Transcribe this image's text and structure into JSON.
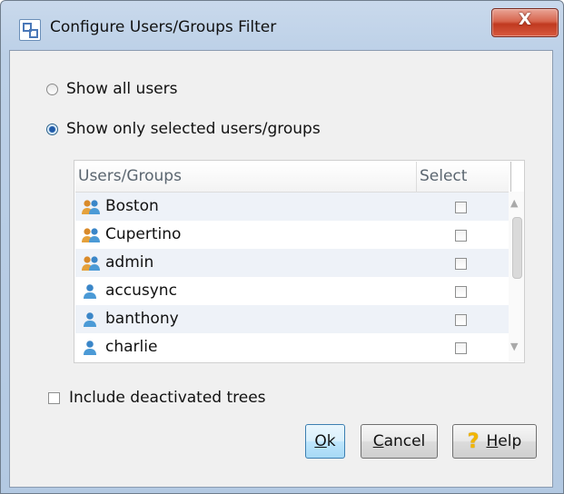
{
  "window": {
    "title": "Configure Users/Groups Filter",
    "close_label": "X"
  },
  "filter": {
    "option_all": "Show all users",
    "option_selected": "Show only selected users/groups",
    "selected_option": "option_selected"
  },
  "table": {
    "columns": [
      "Users/Groups",
      "Select"
    ],
    "rows": [
      {
        "name": "Boston",
        "type": "group-icon",
        "selected": false
      },
      {
        "name": "Cupertino",
        "type": "group-icon",
        "selected": false
      },
      {
        "name": "admin",
        "type": "group-icon",
        "selected": false
      },
      {
        "name": "accusync",
        "type": "user-icon",
        "selected": false
      },
      {
        "name": "banthony",
        "type": "user-icon",
        "selected": false
      },
      {
        "name": "charlie",
        "type": "user-icon",
        "selected": false
      }
    ]
  },
  "include_deactivated": {
    "label": "Include deactivated trees",
    "checked": false
  },
  "buttons": {
    "ok": {
      "mnemonic": "O",
      "rest": "k"
    },
    "cancel": {
      "mnemonic": "C",
      "rest": "ancel"
    },
    "help": {
      "mnemonic": "H",
      "rest": "elp",
      "icon": "help-icon"
    }
  },
  "colors": {
    "accent": "#3c7fb1",
    "title_bar": "#bcd0e7",
    "close": "#c03a20"
  }
}
